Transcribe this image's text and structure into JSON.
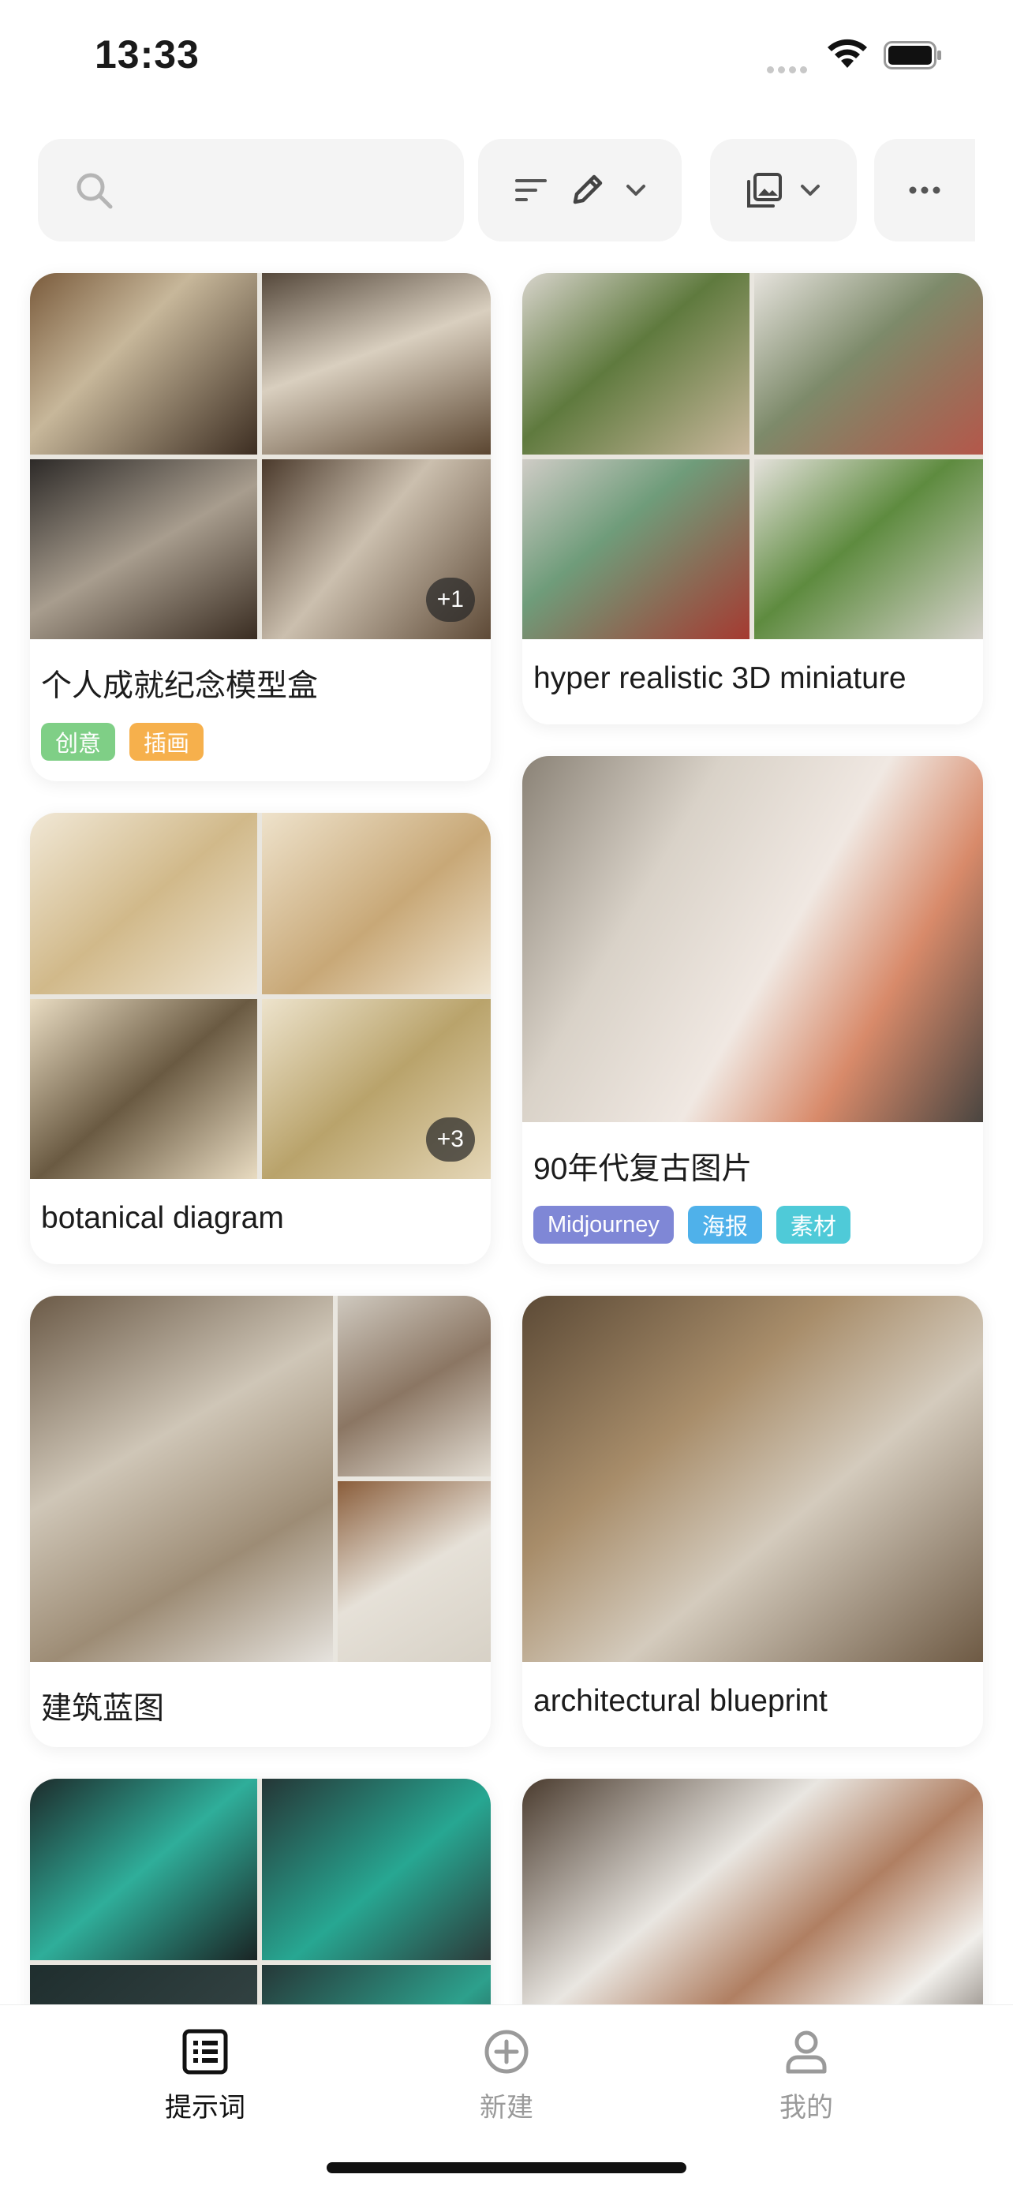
{
  "status_bar": {
    "time": "13:33"
  },
  "toolbar": {
    "search_icon": "search-icon",
    "sort_icon": "sort-lines-icon",
    "edit_icon": "pencil-icon",
    "gallery_icon": "image-gallery-icon",
    "more_icon": "more-dots-icon"
  },
  "cards": [
    {
      "title": "个人成就纪念模型盒",
      "count_badge": "+1",
      "tags": [
        {
          "label": "创意",
          "color": "#7fcf86"
        },
        {
          "label": "插画",
          "color": "#f6b04c"
        }
      ]
    },
    {
      "title": "hyper realistic 3D miniature",
      "count_badge": "",
      "tags": []
    },
    {
      "title": "botanical diagram",
      "count_badge": "+3",
      "tags": []
    },
    {
      "title": "90年代复古图片",
      "count_badge": "",
      "tags": [
        {
          "label": "Midjourney",
          "color": "#7f87d6"
        },
        {
          "label": "海报",
          "color": "#4fb1ea"
        },
        {
          "label": "素材",
          "color": "#4fcad8"
        }
      ]
    },
    {
      "title": "建筑蓝图",
      "count_badge": "",
      "tags": []
    },
    {
      "title": "architectural blueprint",
      "count_badge": "",
      "tags": []
    }
  ],
  "tabbar": {
    "items": [
      {
        "label": "提示词",
        "icon": "list-icon",
        "active": true
      },
      {
        "label": "新建",
        "icon": "plus-circle-icon",
        "active": false
      },
      {
        "label": "我的",
        "icon": "person-icon",
        "active": false
      }
    ]
  },
  "colors": {
    "active_tab": "#111111",
    "inactive_tab": "#9a9a9a",
    "toolbar_bg": "#f4f4f4"
  }
}
